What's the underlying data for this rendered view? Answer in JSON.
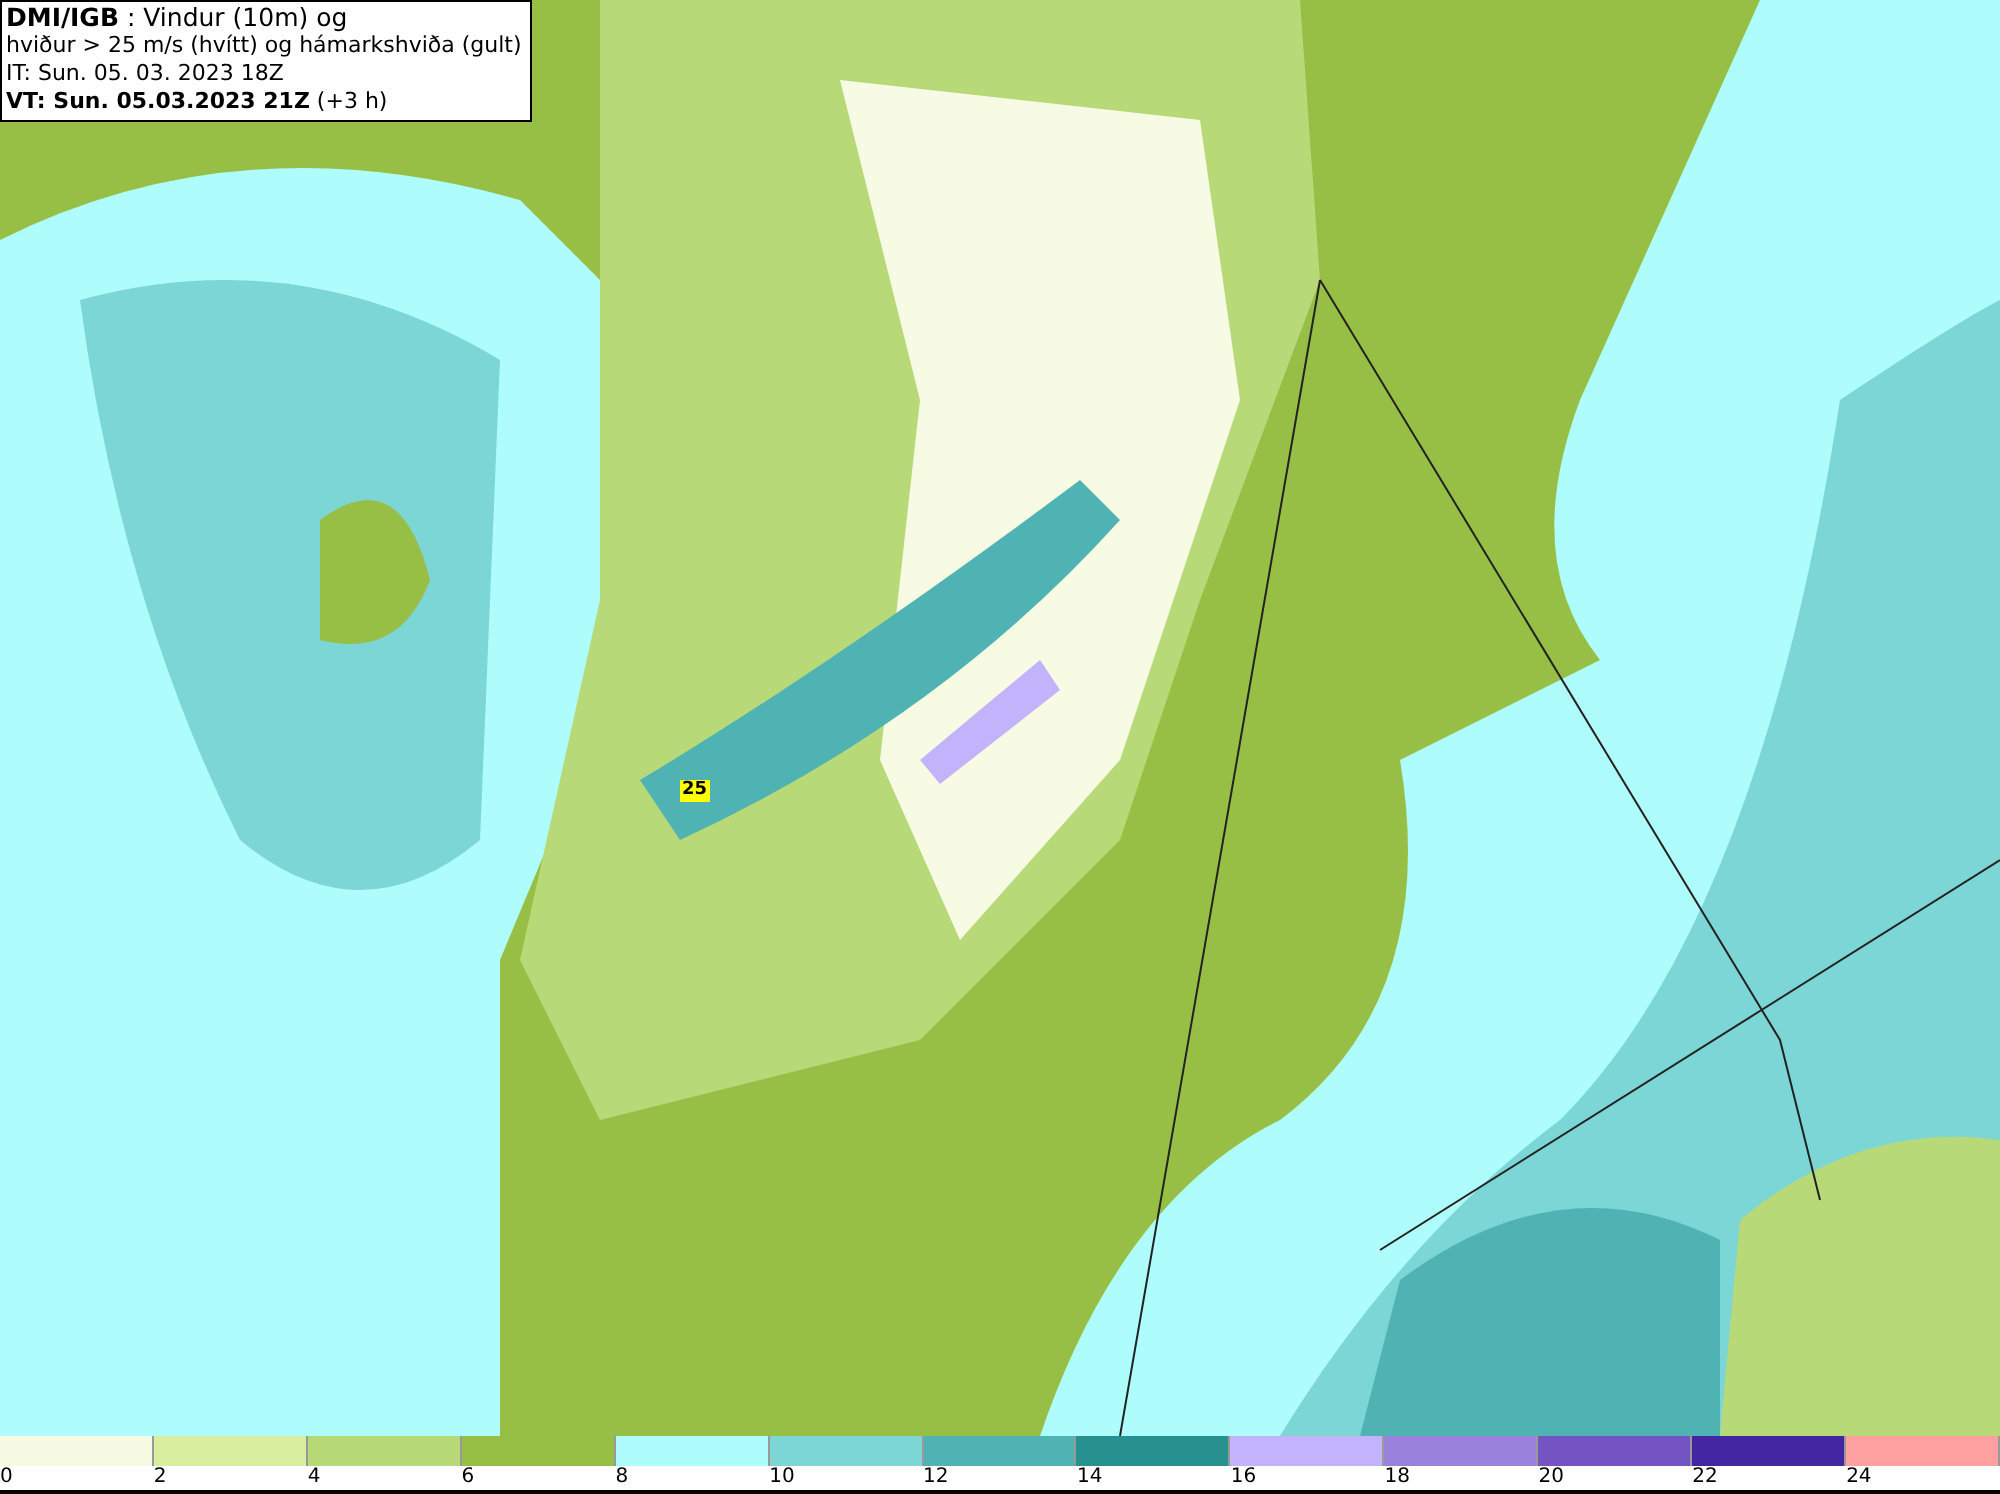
{
  "header": {
    "lines": [
      "**DMI/IGB** : Vindur (10m) og",
      "hviður > 25 m/s (hvítt) og hámarkshviða (gult)",
      "IT: Sun. 05. 03. 2023 18Z",
      "**VT: Sun. 05.03.2023 21Z** (+3 h)"
    ]
  },
  "map": {
    "gust_label": "25"
  },
  "legend": {
    "bins": [
      {
        "color": "#f7fbe3"
      },
      {
        "color": "#d9efa0"
      },
      {
        "color": "#b8d978"
      },
      {
        "color": "#98bf45"
      },
      {
        "color": "#aefcfc"
      },
      {
        "color": "#7dd6d6"
      },
      {
        "color": "#4fb3b3"
      },
      {
        "color": "#26918f"
      },
      {
        "color": "#c3b3fc"
      },
      {
        "color": "#9a82dc"
      },
      {
        "color": "#7454c2"
      },
      {
        "color": "#4426a2"
      },
      {
        "color": "#ffa0a0"
      }
    ],
    "ticks": [
      "0",
      "2",
      "4",
      "6",
      "8",
      "10",
      "12",
      "14",
      "16",
      "18",
      "20",
      "22",
      "24"
    ]
  }
}
